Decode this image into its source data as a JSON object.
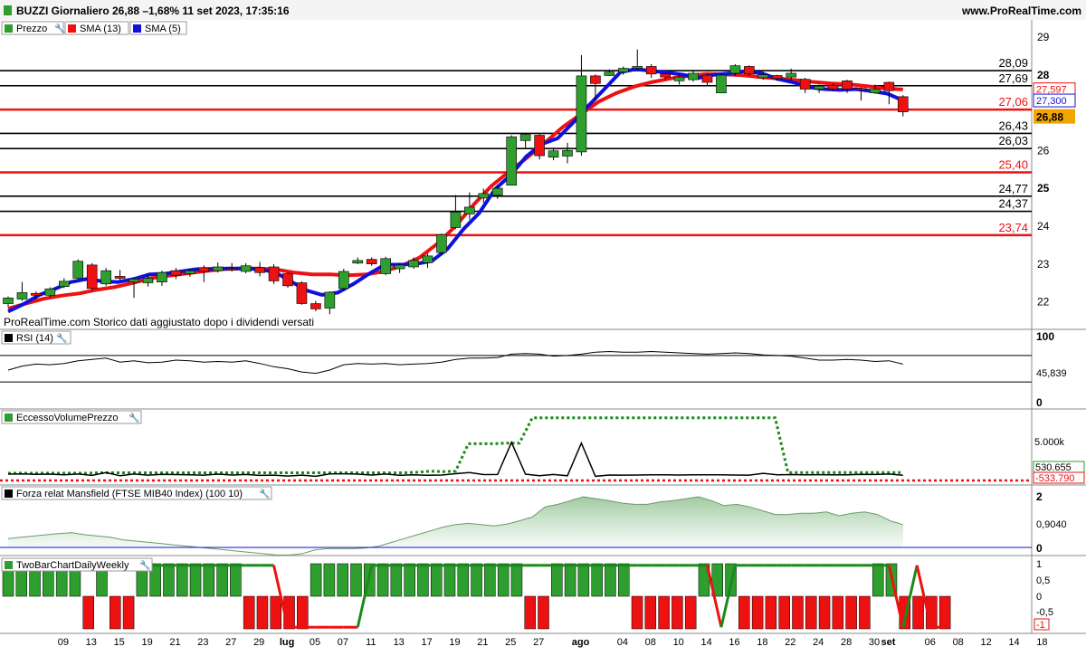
{
  "header": {
    "title": "BUZZI Giornaliero 26,88 –1,68% 11 set 2023, 17:35:16",
    "brand": "www.ProRealTime.com"
  },
  "price_panel": {
    "legend": [
      {
        "label": "Prezzo",
        "color": "#2e9e2e"
      },
      {
        "label": "SMA (13)",
        "color": "#ee1111"
      },
      {
        "label": "SMA (5)",
        "color": "#1010dd"
      }
    ],
    "footnote": "ProRealTime.com  Storico dati aggiustato dopo i dividendi versati",
    "yticks": [
      "29",
      "28",
      "26",
      "25",
      "24",
      "23",
      "22"
    ],
    "hlines": [
      {
        "value": 28.09,
        "label": "28,09",
        "color": "#000000"
      },
      {
        "value": 27.69,
        "label": "27,69",
        "color": "#000000"
      },
      {
        "value": 27.06,
        "label": "27,06",
        "color": "#ee1111"
      },
      {
        "value": 26.43,
        "label": "26,43",
        "color": "#000000"
      },
      {
        "value": 26.03,
        "label": "26,03",
        "color": "#000000"
      },
      {
        "value": 25.4,
        "label": "25,40",
        "color": "#ee1111"
      },
      {
        "value": 24.77,
        "label": "24,77",
        "color": "#000000"
      },
      {
        "value": 24.37,
        "label": "24,37",
        "color": "#000000"
      },
      {
        "value": 23.74,
        "label": "23,74",
        "color": "#ee1111"
      }
    ],
    "badges": [
      {
        "text": "27,597",
        "color": "#ee1111"
      },
      {
        "text": "27,300",
        "color": "#1010dd"
      },
      {
        "text": "26,88",
        "color": "#000000"
      }
    ]
  },
  "rsi_panel": {
    "legend": "RSI (14)",
    "yticks": [
      "100",
      "0"
    ],
    "value_label": "45,839"
  },
  "volume_panel": {
    "legend": "EccessoVolumePrezzo",
    "ytick": "5.000k",
    "labels": [
      "530.655",
      "-533.790"
    ]
  },
  "mansfield_panel": {
    "legend": "Forza relat Mansfield (FTSE MIB40 Index) (100 10)",
    "yticks": [
      "2",
      "0"
    ],
    "value_label": "0,9040"
  },
  "twobar_panel": {
    "legend": "TwoBarChartDailyWeekly",
    "yticks": [
      "1",
      "0,5",
      "0",
      "-0,5"
    ],
    "badge": "-1"
  },
  "x_axis": {
    "labels": [
      {
        "text": "09",
        "bar": 2
      },
      {
        "text": "13",
        "bar": 4
      },
      {
        "text": "15",
        "bar": 6
      },
      {
        "text": "19",
        "bar": 8
      },
      {
        "text": "21",
        "bar": 10
      },
      {
        "text": "23",
        "bar": 12
      },
      {
        "text": "27",
        "bar": 14
      },
      {
        "text": "29",
        "bar": 16
      },
      {
        "text": "lug",
        "bar": 18,
        "bold": true
      },
      {
        "text": "05",
        "bar": 20
      },
      {
        "text": "07",
        "bar": 22
      },
      {
        "text": "11",
        "bar": 24
      },
      {
        "text": "13",
        "bar": 26
      },
      {
        "text": "17",
        "bar": 28
      },
      {
        "text": "19",
        "bar": 30
      },
      {
        "text": "21",
        "bar": 32
      },
      {
        "text": "25",
        "bar": 34
      },
      {
        "text": "27",
        "bar": 36
      },
      {
        "text": "ago",
        "bar": 39,
        "bold": true
      },
      {
        "text": "04",
        "bar": 42
      },
      {
        "text": "08",
        "bar": 44
      },
      {
        "text": "10",
        "bar": 46
      },
      {
        "text": "14",
        "bar": 48
      },
      {
        "text": "16",
        "bar": 50
      },
      {
        "text": "18",
        "bar": 52
      },
      {
        "text": "22",
        "bar": 54
      },
      {
        "text": "24",
        "bar": 56
      },
      {
        "text": "28",
        "bar": 58
      },
      {
        "text": "30",
        "bar": 60
      },
      {
        "text": "set",
        "bar": 61,
        "bold": true
      },
      {
        "text": "06",
        "bar": 64
      },
      {
        "text": "08",
        "bar": 66
      },
      {
        "text": "12",
        "bar": 68
      },
      {
        "text": "14",
        "bar": 70
      },
      {
        "text": "18",
        "bar": 72
      }
    ]
  },
  "chart_data": {
    "type": "candlestick",
    "ylim": [
      21.5,
      29.3
    ],
    "candles": [
      [
        21.93,
        22.08,
        21.85,
        22.12
      ],
      [
        22.05,
        22.22,
        22.0,
        22.5
      ],
      [
        22.2,
        22.15,
        22.05,
        22.25
      ],
      [
        22.15,
        22.32,
        22.1,
        22.36
      ],
      [
        22.38,
        22.52,
        22.34,
        22.6
      ],
      [
        22.6,
        23.05,
        22.58,
        23.1
      ],
      [
        22.95,
        22.33,
        22.28,
        23.0
      ],
      [
        22.45,
        22.8,
        22.4,
        22.87
      ],
      [
        22.65,
        22.6,
        22.55,
        22.82
      ],
      [
        22.5,
        22.58,
        22.08,
        22.62
      ],
      [
        22.48,
        22.6,
        22.38,
        22.7
      ],
      [
        22.5,
        22.75,
        22.4,
        22.8
      ],
      [
        22.8,
        22.68,
        22.58,
        22.87
      ],
      [
        22.72,
        22.8,
        22.64,
        22.85
      ],
      [
        22.88,
        22.78,
        22.5,
        22.94
      ],
      [
        22.8,
        22.9,
        22.75,
        23.02
      ],
      [
        22.86,
        22.84,
        22.78,
        23.0
      ],
      [
        22.78,
        22.93,
        22.73,
        23.0
      ],
      [
        22.88,
        22.75,
        22.65,
        23.03
      ],
      [
        22.9,
        22.53,
        22.45,
        22.97
      ],
      [
        22.72,
        22.4,
        22.35,
        22.75
      ],
      [
        22.48,
        21.93,
        21.9,
        22.52
      ],
      [
        21.93,
        21.79,
        21.73,
        22.0
      ],
      [
        21.81,
        22.23,
        21.65,
        22.25
      ],
      [
        22.33,
        22.78,
        22.28,
        22.85
      ],
      [
        23.0,
        23.07,
        22.97,
        23.15
      ],
      [
        23.1,
        22.98,
        22.93,
        23.15
      ],
      [
        22.72,
        23.12,
        22.68,
        23.17
      ],
      [
        22.85,
        22.95,
        22.74,
        23.0
      ],
      [
        22.9,
        23.07,
        22.85,
        23.15
      ],
      [
        23.01,
        23.19,
        22.88,
        23.25
      ],
      [
        23.28,
        23.75,
        23.22,
        23.78
      ],
      [
        23.94,
        24.35,
        23.9,
        24.8
      ],
      [
        24.3,
        24.48,
        24.15,
        24.87
      ],
      [
        24.72,
        24.84,
        24.6,
        24.97
      ],
      [
        24.8,
        24.98,
        24.7,
        25.06
      ],
      [
        25.06,
        26.34,
        25.06,
        26.38
      ],
      [
        26.24,
        26.4,
        26.05,
        26.45
      ],
      [
        26.38,
        25.84,
        25.74,
        26.42
      ],
      [
        25.8,
        25.97,
        25.72,
        26.05
      ],
      [
        25.83,
        25.98,
        25.64,
        26.18
      ],
      [
        25.94,
        27.95,
        25.84,
        28.5
      ],
      [
        27.95,
        27.75,
        27.3,
        27.99
      ],
      [
        27.96,
        28.05,
        27.95,
        28.12
      ],
      [
        28.05,
        28.15,
        27.98,
        28.2
      ],
      [
        28.15,
        28.2,
        28.12,
        28.65
      ],
      [
        28.2,
        28.0,
        27.9,
        28.26
      ],
      [
        28.0,
        27.92,
        27.86,
        28.02
      ],
      [
        27.82,
        27.92,
        27.72,
        27.98
      ],
      [
        27.85,
        28.02,
        27.8,
        28.1
      ],
      [
        27.97,
        27.78,
        27.7,
        28.02
      ],
      [
        27.5,
        27.97,
        27.5,
        28.0
      ],
      [
        28.02,
        28.22,
        27.95,
        28.26
      ],
      [
        28.2,
        28.0,
        27.95,
        28.23
      ],
      [
        27.9,
        27.98,
        27.85,
        28.05
      ],
      [
        27.96,
        27.88,
        27.82,
        27.98
      ],
      [
        27.92,
        28.02,
        27.82,
        28.14
      ],
      [
        27.86,
        27.6,
        27.5,
        27.9
      ],
      [
        27.6,
        27.68,
        27.5,
        27.72
      ],
      [
        27.7,
        27.6,
        27.55,
        27.75
      ],
      [
        27.82,
        27.6,
        27.5,
        27.85
      ],
      [
        27.62,
        27.58,
        27.3,
        27.65
      ],
      [
        27.5,
        27.6,
        27.48,
        27.72
      ],
      [
        27.78,
        27.56,
        27.2,
        27.8
      ],
      [
        27.4,
        27.0,
        26.88,
        27.44
      ]
    ],
    "sma13": [
      21.8,
      21.93,
      22.06,
      22.14,
      22.2,
      22.3,
      22.37,
      22.48,
      22.6,
      22.67,
      22.73,
      22.79,
      22.84,
      22.86,
      22.86,
      22.83,
      22.75,
      22.7,
      22.7,
      22.68,
      22.7,
      22.78,
      22.93,
      23.15,
      23.52,
      23.98,
      24.54,
      25.04,
      25.42,
      25.79,
      26.19,
      26.6,
      26.94,
      27.27,
      27.5,
      27.67,
      27.79,
      27.88,
      27.95,
      28.0,
      27.99,
      27.97,
      27.92,
      27.88,
      27.84,
      27.79,
      27.75,
      27.73,
      27.68,
      27.62,
      27.59
    ],
    "sma13_start": 0,
    "sma5": [
      21.72,
      21.92,
      22.16,
      22.32,
      22.5,
      22.58,
      22.52,
      22.5,
      22.58,
      22.7,
      22.72,
      22.78,
      22.84,
      22.85,
      22.86,
      22.86,
      22.84,
      22.76,
      22.52,
      22.28,
      22.16,
      22.22,
      22.45,
      22.72,
      22.96,
      22.96,
      22.98,
      23.06,
      23.38,
      23.9,
      24.32,
      24.95,
      25.32,
      25.82,
      26.15,
      26.3,
      26.72,
      27.18,
      27.61,
      28.05,
      28.13,
      28.08,
      28.04,
      27.98,
      27.9,
      27.98,
      28.02,
      28.08,
      28.02,
      27.87,
      27.78,
      27.65,
      27.6,
      27.58,
      27.6,
      27.55,
      27.48,
      27.3
    ],
    "sma5_start": 4,
    "rsi": [
      48,
      54,
      57,
      56,
      58,
      62,
      64,
      66,
      60,
      62,
      59,
      60,
      63,
      62,
      60,
      61,
      60,
      62,
      58,
      53,
      50,
      45,
      43,
      48,
      56,
      58,
      57,
      58,
      56,
      57,
      58,
      60,
      64,
      66,
      66,
      67,
      72,
      73,
      72,
      69,
      70,
      72,
      75,
      76,
      75,
      75,
      76,
      75,
      74,
      73,
      72,
      73,
      74,
      73,
      71,
      70,
      69,
      66,
      63,
      63,
      64,
      63,
      61,
      62,
      57
    ],
    "volume_line": [
      380,
      420,
      350,
      390,
      300,
      400,
      200,
      600,
      150,
      400,
      250,
      350,
      320,
      300,
      250,
      380,
      260,
      330,
      210,
      240,
      110,
      250,
      80,
      420,
      440,
      380,
      260,
      400,
      220,
      300,
      230,
      260,
      450,
      600,
      320,
      330,
      4900,
      380,
      150,
      330,
      160,
      4800,
      80,
      260,
      240,
      260,
      280,
      280,
      260,
      300,
      280,
      300,
      260,
      240,
      500,
      300,
      320,
      300,
      310,
      280,
      300,
      350,
      340,
      400,
      230
    ],
    "volume_dots": [
      520,
      530,
      520,
      540,
      520,
      540,
      520,
      580,
      580,
      580,
      580,
      580,
      580,
      580,
      580,
      580,
      580,
      580,
      580,
      580,
      580,
      580,
      580,
      580,
      580,
      580,
      580,
      580,
      580,
      580,
      550,
      580,
      650,
      800,
      750,
      800,
      4700,
      4700,
      4700,
      4800,
      4800,
      8400,
      8400,
      8400,
      8400,
      8400,
      8400,
      8400,
      8400,
      8400,
      8400,
      8400,
      8400,
      8400,
      8400,
      8400,
      8400,
      8400,
      8400,
      8400,
      8400,
      600,
      600,
      600,
      600,
      600,
      600,
      600,
      600,
      600,
      600
    ],
    "volume_red_dots": -260,
    "mansfield": [
      0.35,
      0.4,
      0.45,
      0.5,
      0.55,
      0.58,
      0.5,
      0.45,
      0.4,
      0.3,
      0.25,
      0.2,
      0.15,
      0.1,
      0.05,
      0.0,
      -0.05,
      -0.1,
      -0.15,
      -0.2,
      -0.25,
      -0.3,
      -0.3,
      -0.25,
      -0.1,
      -0.05,
      -0.05,
      -0.05,
      -0.02,
      0.05,
      0.2,
      0.35,
      0.5,
      0.65,
      0.8,
      0.9,
      0.95,
      0.9,
      0.85,
      0.92,
      1.05,
      1.2,
      1.6,
      1.7,
      1.85,
      2.0,
      1.92,
      1.85,
      1.75,
      1.7,
      1.7,
      1.8,
      1.85,
      1.92,
      2.0,
      1.85,
      1.65,
      1.7,
      1.6,
      1.45,
      1.3,
      1.3,
      1.35,
      1.35,
      1.4,
      1.25,
      1.35,
      1.4,
      1.3,
      1.05,
      0.9
    ],
    "twobar": [
      1,
      1,
      1,
      1,
      1,
      1,
      -1,
      1,
      -1,
      -1,
      1,
      1,
      1,
      1,
      1,
      1,
      1,
      1,
      -1,
      -1,
      -1,
      -1,
      -1,
      1,
      1,
      1,
      1,
      1,
      1,
      1,
      1,
      1,
      1,
      1,
      1,
      1,
      1,
      1,
      1,
      -1,
      -1,
      1,
      1,
      1,
      1,
      1,
      1,
      -1,
      -1,
      -1,
      -1,
      -1,
      1,
      1,
      1,
      -1,
      -1,
      -1,
      -1,
      -1,
      -1,
      -1,
      -1,
      -1,
      -1,
      1,
      1,
      -1,
      -1,
      -1,
      -1
    ],
    "twobar_line": [
      1,
      1,
      1,
      1,
      1,
      1,
      1,
      1,
      1,
      1,
      1,
      1,
      1,
      1,
      1,
      1,
      1,
      1,
      1,
      1,
      -1,
      -1,
      -1,
      -1,
      -1,
      -1,
      1,
      1,
      1,
      1,
      1,
      1,
      1,
      1,
      1,
      1,
      1,
      1,
      1,
      1,
      1,
      1,
      1,
      1,
      1,
      1,
      1,
      1,
      1,
      1,
      1,
      -1,
      1,
      1,
      1,
      1,
      1,
      1,
      1,
      1,
      1,
      1,
      1,
      1,
      -1,
      1,
      -1,
      -1
    ]
  }
}
